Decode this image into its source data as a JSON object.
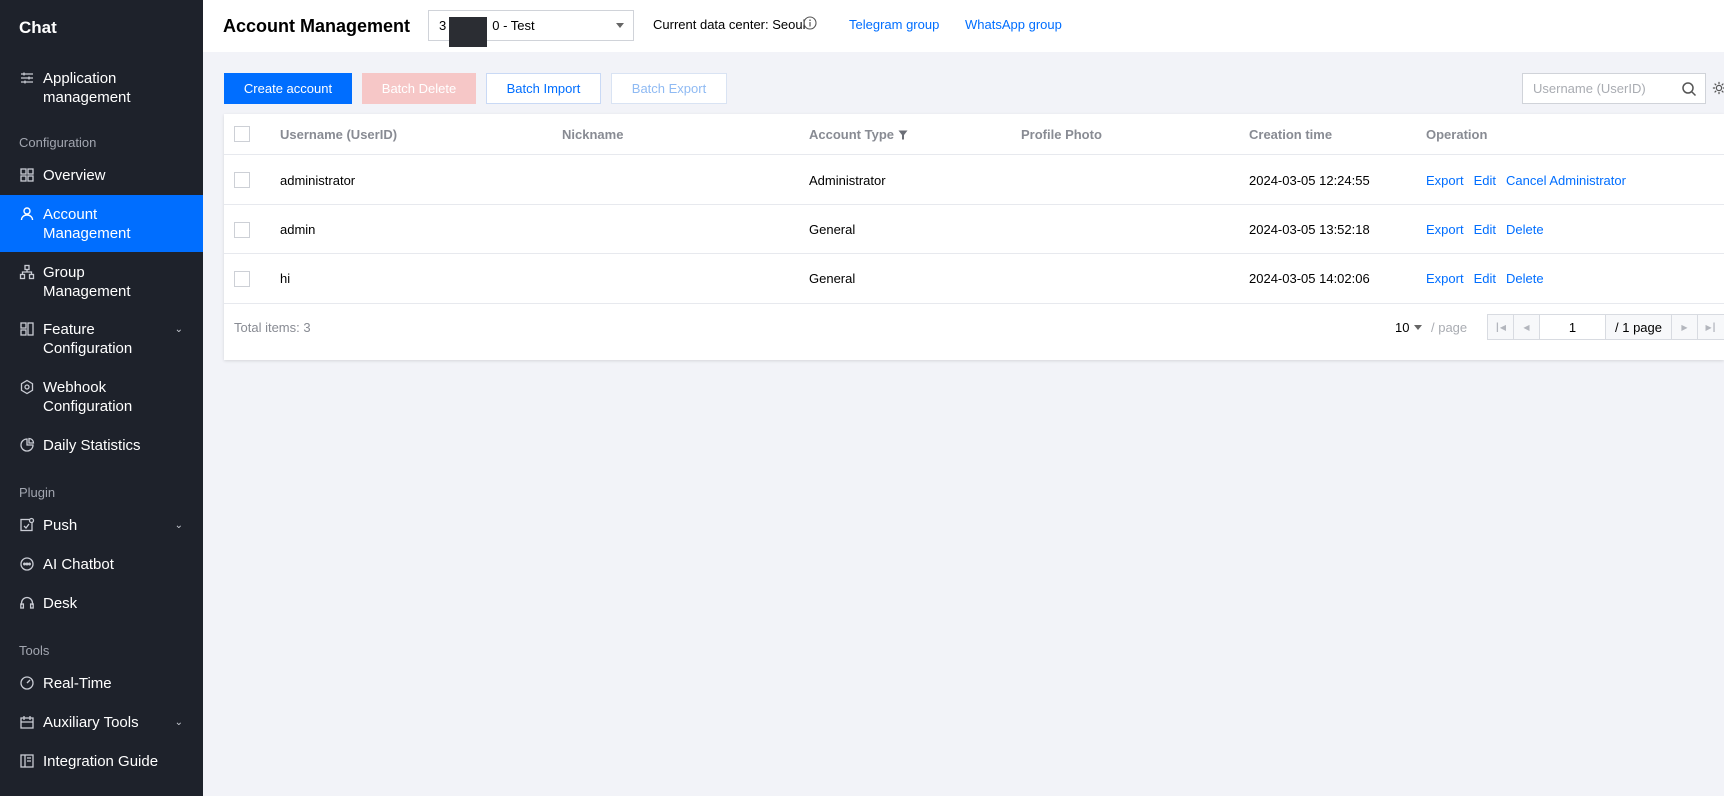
{
  "sidebar": {
    "brand": "Chat",
    "items": [
      {
        "label": "Application management",
        "icon": "sliders-icon"
      },
      {
        "label": "Overview",
        "icon": "grid-icon"
      },
      {
        "label": "Account Management",
        "icon": "user-icon",
        "active": true
      },
      {
        "label": "Group Management",
        "icon": "hierarchy-icon"
      },
      {
        "label": "Feature Configuration",
        "icon": "puzzle-icon",
        "expandable": true
      },
      {
        "label": "Webhook Configuration",
        "icon": "webhook-icon"
      },
      {
        "label": "Daily Statistics",
        "icon": "pie-chart-icon"
      },
      {
        "label": "Push",
        "icon": "push-icon",
        "expandable": true
      },
      {
        "label": "AI Chatbot",
        "icon": "chatbot-icon"
      },
      {
        "label": "Desk",
        "icon": "headset-icon"
      },
      {
        "label": "Real-Time",
        "icon": "gauge-icon"
      },
      {
        "label": "Auxiliary Tools",
        "icon": "toolbox-icon",
        "expandable": true
      },
      {
        "label": "Integration Guide",
        "icon": "book-icon"
      }
    ],
    "sections": {
      "configuration": "Configuration",
      "plugin": "Plugin",
      "tools": "Tools"
    }
  },
  "header": {
    "title": "Account Management",
    "app_select_prefix": "3",
    "app_select_suffix": "0 - Test",
    "data_center": "Current data center: Seoul",
    "telegram": "Telegram group",
    "whatsapp": "WhatsApp group"
  },
  "toolbar": {
    "create": "Create account",
    "batch_delete": "Batch Delete",
    "batch_import": "Batch Import",
    "batch_export": "Batch Export",
    "search_placeholder": "Username (UserID)"
  },
  "table": {
    "headers": {
      "username": "Username (UserID)",
      "nickname": "Nickname",
      "account_type": "Account Type",
      "profile_photo": "Profile Photo",
      "creation_time": "Creation time",
      "operation": "Operation"
    },
    "rows": [
      {
        "username": "administrator",
        "nickname": "",
        "account_type": "Administrator",
        "creation_time": "2024-03-05 12:24:55",
        "ops": [
          "Export",
          "Edit",
          "Cancel Administrator"
        ]
      },
      {
        "username": "admin",
        "nickname": "",
        "account_type": "General",
        "creation_time": "2024-03-05 13:52:18",
        "ops": [
          "Export",
          "Edit",
          "Delete"
        ]
      },
      {
        "username": "hi",
        "nickname": "",
        "account_type": "General",
        "creation_time": "2024-03-05 14:02:06",
        "ops": [
          "Export",
          "Edit",
          "Delete"
        ]
      }
    ]
  },
  "footer": {
    "total": "Total items:  3",
    "page_size": "10",
    "per_page": "/ page",
    "current_page": "1",
    "total_pages": "/ 1 page"
  },
  "colors": {
    "sidebar_bg": "#1e222b",
    "accent": "#006eff",
    "danger_disabled": "#f6c7c7",
    "page_bg": "#f2f3f8"
  }
}
